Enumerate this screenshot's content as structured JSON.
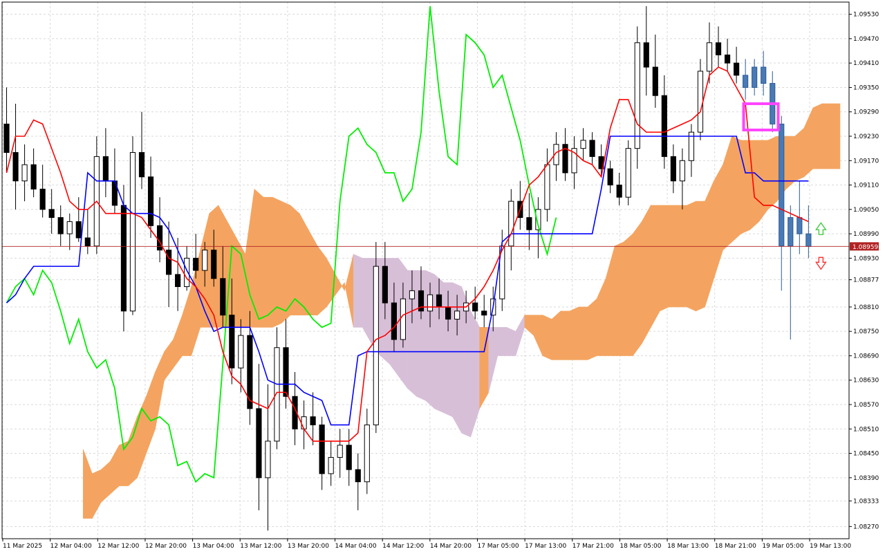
{
  "chart_data": {
    "type": "candlestick",
    "symbol_note": "",
    "ylim": [
      1.0824,
      1.0956
    ],
    "y_ticks": [
      "1.09530",
      "1.09470",
      "1.09410",
      "1.09350",
      "1.09290",
      "1.09230",
      "1.09170",
      "1.09110",
      "1.09050",
      "1.08990",
      "1.08930",
      "1.08877",
      "1.08810",
      "1.08750",
      "1.08690",
      "1.08630",
      "1.08570",
      "1.08510",
      "1.08450",
      "1.08390",
      "1.08333",
      "1.08270"
    ],
    "x_ticks": [
      "11 Mar 2025",
      "12 Mar 04:00",
      "12 Mar 12:00",
      "12 Mar 20:00",
      "13 Mar 04:00",
      "13 Mar 12:00",
      "13 Mar 20:00",
      "14 Mar 04:00",
      "14 Mar 12:00",
      "14 Mar 20:00",
      "17 Mar 05:00",
      "17 Mar 13:00",
      "17 Mar 21:00",
      "18 Mar 05:00",
      "18 Mar 13:00",
      "18 Mar 21:00",
      "19 Mar 05:00",
      "19 Mar 13:00"
    ],
    "current_price": "1.08959",
    "current_price_value": 1.08959,
    "colors": {
      "background": "#ffffff",
      "grid": "#d9d9d9",
      "bull_candle": "#ffffff",
      "bear_candle": "#000000",
      "last_bull_candle": "#4a7ab5",
      "tenkan": "#ff0000",
      "kijun": "#0000ff",
      "chikou": "#00ee00",
      "kumo_bull": "#f4a460",
      "kumo_bear": "#d8bfd8",
      "price_line": "#b22222",
      "price_tag": "#b22222",
      "highlight_box": "#ff44ff",
      "arrow_up": "#44cc44",
      "arrow_down": "#ff3333"
    },
    "candles": [
      [
        1.0926,
        1.0935,
        1.0914,
        1.0919
      ],
      [
        1.0919,
        1.0931,
        1.0905,
        1.0912
      ],
      [
        1.0912,
        1.0921,
        1.0907,
        1.0916
      ],
      [
        1.0916,
        1.092,
        1.0908,
        1.091
      ],
      [
        1.091,
        1.0916,
        1.0903,
        1.0905
      ],
      [
        1.0905,
        1.091,
        1.0899,
        1.0903
      ],
      [
        1.0903,
        1.0906,
        1.0896,
        1.0899
      ],
      [
        1.0899,
        1.0904,
        1.0895,
        1.0902
      ],
      [
        1.0902,
        1.0908,
        1.0897,
        1.0898
      ],
      [
        1.0898,
        1.0905,
        1.0894,
        1.0896
      ],
      [
        1.0896,
        1.0923,
        1.0894,
        1.0918
      ],
      [
        1.0918,
        1.0925,
        1.0908,
        1.0912
      ],
      [
        1.0912,
        1.092,
        1.0904,
        1.0906
      ],
      [
        1.0906,
        1.0911,
        1.0875,
        1.088
      ],
      [
        1.088,
        1.0923,
        1.0879,
        1.0919
      ],
      [
        1.0919,
        1.0929,
        1.091,
        1.0913
      ],
      [
        1.0913,
        1.0918,
        1.0898,
        1.0901
      ],
      [
        1.0901,
        1.0908,
        1.0892,
        1.0895
      ],
      [
        1.0895,
        1.0902,
        1.0881,
        1.0889
      ],
      [
        1.0889,
        1.0898,
        1.088,
        1.0886
      ],
      [
        1.0886,
        1.0896,
        1.0885,
        1.0893
      ],
      [
        1.0893,
        1.0899,
        1.0888,
        1.089
      ],
      [
        1.089,
        1.0897,
        1.0886,
        1.0895
      ],
      [
        1.0895,
        1.09,
        1.0886,
        1.0888
      ],
      [
        1.0888,
        1.0896,
        1.0876,
        1.0879
      ],
      [
        1.0879,
        1.0888,
        1.0862,
        1.0866
      ],
      [
        1.0866,
        1.0878,
        1.086,
        1.0874
      ],
      [
        1.0874,
        1.088,
        1.0852,
        1.0856
      ],
      [
        1.0856,
        1.0867,
        1.0831,
        1.0839
      ],
      [
        1.0839,
        1.0862,
        1.0826,
        1.0848
      ],
      [
        1.0848,
        1.0876,
        1.0846,
        1.0871
      ],
      [
        1.0871,
        1.0878,
        1.0856,
        1.0859
      ],
      [
        1.0859,
        1.0865,
        1.0847,
        1.0851
      ],
      [
        1.0851,
        1.0858,
        1.0846,
        1.0854
      ],
      [
        1.0854,
        1.086,
        1.0847,
        1.0852
      ],
      [
        1.0852,
        1.0854,
        1.0836,
        1.084
      ],
      [
        1.084,
        1.0848,
        1.0837,
        1.0844
      ],
      [
        1.0844,
        1.0851,
        1.0839,
        1.0847
      ],
      [
        1.0847,
        1.0851,
        1.0837,
        1.0841
      ],
      [
        1.0841,
        1.0845,
        1.0831,
        1.0838
      ],
      [
        1.0838,
        1.0856,
        1.0835,
        1.0852
      ],
      [
        1.0852,
        1.0897,
        1.085,
        1.0891
      ],
      [
        1.0891,
        1.0897,
        1.0878,
        1.0882
      ],
      [
        1.0882,
        1.0887,
        1.087,
        1.0873
      ],
      [
        1.0873,
        1.0887,
        1.0871,
        1.0883
      ],
      [
        1.0883,
        1.089,
        1.0877,
        1.0885
      ],
      [
        1.0885,
        1.0891,
        1.0878,
        1.088
      ],
      [
        1.088,
        1.0887,
        1.0876,
        1.0884
      ],
      [
        1.0884,
        1.0888,
        1.0878,
        1.0881
      ],
      [
        1.0881,
        1.0885,
        1.0875,
        1.0878
      ],
      [
        1.0878,
        1.0884,
        1.0874,
        1.088
      ],
      [
        1.088,
        1.0885,
        1.0877,
        1.0882
      ],
      [
        1.0882,
        1.0886,
        1.0878,
        1.088
      ],
      [
        1.088,
        1.0884,
        1.0876,
        1.0879
      ],
      [
        1.0879,
        1.0886,
        1.0875,
        1.0883
      ],
      [
        1.0883,
        1.09,
        1.088,
        1.0896
      ],
      [
        1.0896,
        1.091,
        1.089,
        1.0907
      ],
      [
        1.0907,
        1.0912,
        1.09,
        1.0903
      ],
      [
        1.0903,
        1.0909,
        1.0895,
        1.09
      ],
      [
        1.09,
        1.0908,
        1.0893,
        1.0905
      ],
      [
        1.0905,
        1.092,
        1.0902,
        1.0916
      ],
      [
        1.0916,
        1.0924,
        1.0912,
        1.0921
      ],
      [
        1.0921,
        1.0925,
        1.0912,
        1.0914
      ],
      [
        1.0914,
        1.0923,
        1.091,
        1.092
      ],
      [
        1.092,
        1.0925,
        1.0917,
        1.0922
      ],
      [
        1.0922,
        1.0924,
        1.0916,
        1.0918
      ],
      [
        1.0918,
        1.0921,
        1.0913,
        1.0915
      ],
      [
        1.0915,
        1.0917,
        1.0909,
        1.0911
      ],
      [
        1.0911,
        1.0914,
        1.0906,
        1.0908
      ],
      [
        1.0908,
        1.0922,
        1.0906,
        1.092
      ],
      [
        1.092,
        1.095,
        1.0915,
        1.0946
      ],
      [
        1.0946,
        1.0955,
        1.0933,
        1.094
      ],
      [
        1.094,
        1.0948,
        1.093,
        1.0933
      ],
      [
        1.0933,
        1.0938,
        1.0915,
        1.0918
      ],
      [
        1.0918,
        1.0921,
        1.0909,
        1.0912
      ],
      [
        1.0912,
        1.092,
        1.0905,
        1.0917
      ],
      [
        1.0917,
        1.0926,
        1.0913,
        1.0924
      ],
      [
        1.0924,
        1.0942,
        1.0922,
        1.0939
      ],
      [
        1.0939,
        1.0951,
        1.0936,
        1.0946
      ],
      [
        1.0946,
        1.095,
        1.094,
        1.0943
      ],
      [
        1.0943,
        1.0947,
        1.0939,
        1.0941
      ],
      [
        1.0941,
        1.0945,
        1.0936,
        1.0938
      ],
      [
        1.0938,
        1.0942,
        1.0932,
        1.0935
      ],
      [
        1.0935,
        1.0942,
        1.0933,
        1.094
      ],
      [
        1.094,
        1.0944,
        1.0933,
        1.0936
      ],
      [
        1.0936,
        1.0939,
        1.0924,
        1.0926
      ],
      [
        1.0926,
        1.0928,
        1.0885,
        1.0896
      ],
      [
        1.0896,
        1.0906,
        1.0873,
        1.0903
      ],
      [
        1.0903,
        1.0912,
        1.0894,
        1.0899
      ],
      [
        1.0899,
        1.0906,
        1.0893,
        1.08959
      ]
    ],
    "ichimoku": {
      "tenkan": [
        1.0914,
        1.0923,
        1.0923,
        1.0927,
        1.0926,
        1.092,
        1.0914,
        1.0907,
        1.0905,
        1.0905,
        1.0907,
        1.0904,
        1.0904,
        1.0904,
        1.0904,
        1.0903,
        1.09,
        1.0897,
        1.0893,
        1.0892,
        1.0888,
        1.0886,
        1.0883,
        1.0879,
        1.087,
        1.0864,
        1.0862,
        1.0858,
        1.0857,
        1.0856,
        1.086,
        1.086,
        1.0856,
        1.0851,
        1.0848,
        1.0848,
        1.0848,
        1.0848,
        1.0848,
        1.085,
        1.087,
        1.0873,
        1.0874,
        1.0876,
        1.0879,
        1.088,
        1.0881,
        1.0881,
        1.0881,
        1.0881,
        1.0881,
        1.0881,
        1.0883,
        1.0886,
        1.089,
        1.0895,
        1.0899,
        1.0905,
        1.0911,
        1.0913,
        1.0916,
        1.0919,
        1.092,
        1.0919,
        1.0917,
        1.0916,
        1.0913,
        1.0925,
        1.0932,
        1.0932,
        1.0926,
        1.0924,
        1.0924,
        1.0924,
        1.0925,
        1.0926,
        1.0927,
        1.0929,
        1.0938,
        1.094,
        1.0939,
        1.0935,
        1.0931,
        1.0908,
        1.0906,
        1.0906,
        1.0905,
        1.0904,
        1.0903,
        1.0902
      ],
      "kijun": [
        1.0882,
        1.0884,
        1.0888,
        1.0891,
        1.0891,
        1.0891,
        1.0891,
        1.0891,
        1.0891,
        1.0914,
        1.0912,
        1.0912,
        1.0912,
        1.0906,
        1.0904,
        1.0904,
        1.0904,
        1.0903,
        1.09,
        1.0895,
        1.089,
        1.0886,
        1.088,
        1.0875,
        1.0876,
        1.0876,
        1.0876,
        1.0876,
        1.087,
        1.0863,
        1.0862,
        1.0862,
        1.0862,
        1.086,
        1.0859,
        1.0858,
        1.0852,
        1.0852,
        1.0852,
        1.0869,
        1.087,
        1.087,
        1.087,
        1.087,
        1.087,
        1.087,
        1.087,
        1.087,
        1.087,
        1.087,
        1.087,
        1.087,
        1.087,
        1.087,
        1.0881,
        1.0897,
        1.0899,
        1.0899,
        1.0899,
        1.0899,
        1.0899,
        1.0899,
        1.0899,
        1.0899,
        1.0899,
        1.0899,
        1.091,
        1.0923,
        1.0923,
        1.0923,
        1.0923,
        1.0923,
        1.0923,
        1.0923,
        1.0923,
        1.0923,
        1.0923,
        1.0923,
        1.0923,
        1.0923,
        1.0923,
        1.0923,
        1.0914,
        1.0914,
        1.0912,
        1.0912,
        1.0912,
        1.0912,
        1.0912,
        1.0912
      ],
      "chikou": [
        1.0882,
        1.0886,
        1.0888,
        1.0884,
        1.089,
        1.0887,
        1.088,
        1.0872,
        1.0878,
        1.087,
        1.0866,
        1.0868,
        1.0861,
        1.0846,
        1.0849,
        1.0856,
        1.0853,
        1.0854,
        1.0852,
        1.0842,
        1.0843,
        1.0838,
        1.084,
        1.0839,
        1.0867,
        1.0896,
        1.0894,
        1.0884,
        1.0878,
        1.0879,
        1.0881,
        1.088,
        1.0883,
        1.0881,
        1.0878,
        1.0876,
        1.0877,
        1.0907,
        1.0923,
        1.0925,
        1.0921,
        1.0919,
        1.0914,
        1.0914,
        1.0907,
        1.091,
        1.0924,
        1.0955,
        1.0934,
        1.0918,
        1.0916,
        1.0948,
        1.0946,
        1.0943,
        1.0935,
        1.0938,
        1.093,
        1.0922,
        1.0911,
        1.0901,
        1.0894,
        1.0903
      ]
    },
    "kumo": {
      "upper": [
        1.0846,
        1.084,
        1.0841,
        1.0843,
        1.0847,
        1.0848,
        1.0854,
        1.0859,
        1.0865,
        1.087,
        1.0873,
        1.0879,
        1.0886,
        1.0895,
        1.0904,
        1.0906,
        1.0902,
        1.0898,
        1.0894,
        1.091,
        1.0908,
        1.0908,
        1.0907,
        1.0906,
        1.0904,
        1.09,
        1.0896,
        1.0893,
        1.0889,
        1.0885,
        1.0894,
        1.0893,
        1.0893,
        1.0893,
        1.0893,
        1.0893,
        1.089,
        1.089,
        1.089,
        1.0889,
        1.0887,
        1.0887,
        1.0886,
        1.088,
        1.0876,
        1.0876,
        1.0876,
        1.0876,
        1.0875,
        1.0879,
        1.0879,
        1.0879,
        1.0878,
        1.088,
        1.088,
        1.0881,
        1.0881,
        1.0883,
        1.0888,
        1.0896,
        1.0897,
        1.0899,
        1.0902,
        1.0906,
        1.0906,
        1.0906,
        1.0906,
        1.0906,
        1.0907,
        1.0907,
        1.0912,
        1.0916,
        1.0923,
        1.0922,
        1.0922,
        1.0922,
        1.0922,
        1.0923,
        1.0923,
        1.0923,
        1.0925,
        1.093,
        1.0931,
        1.0931,
        1.0931
      ],
      "lower": [
        1.0829,
        1.0829,
        1.0833,
        1.0835,
        1.0837,
        1.0837,
        1.0839,
        1.0845,
        1.0851,
        1.0863,
        1.0866,
        1.0869,
        1.0869,
        1.0876,
        1.0876,
        1.0876,
        1.0876,
        1.0876,
        1.0876,
        1.0876,
        1.0876,
        1.0876,
        1.0877,
        1.0879,
        1.0879,
        1.0879,
        1.0879,
        1.0881,
        1.0884,
        1.0887,
        1.0876,
        1.0876,
        1.0872,
        1.0869,
        1.0867,
        1.0864,
        1.0861,
        1.0859,
        1.0858,
        1.0856,
        1.0855,
        1.0854,
        1.085,
        1.0849,
        1.0856,
        1.086,
        1.0869,
        1.0869,
        1.0869,
        1.0876,
        1.0874,
        1.0869,
        1.0868,
        1.0868,
        1.0868,
        1.0868,
        1.0868,
        1.0869,
        1.0869,
        1.0869,
        1.0869,
        1.0869,
        1.0872,
        1.0876,
        1.088,
        1.0881,
        1.0881,
        1.0881,
        1.088,
        1.0881,
        1.0888,
        1.0895,
        1.0897,
        1.0899,
        1.09,
        1.0902,
        1.0905,
        1.0907,
        1.091,
        1.0912,
        1.0913,
        1.0915,
        1.0915,
        1.0915,
        1.0915
      ]
    },
    "x_labels_note": "",
    "grid": true,
    "legend": "none"
  }
}
